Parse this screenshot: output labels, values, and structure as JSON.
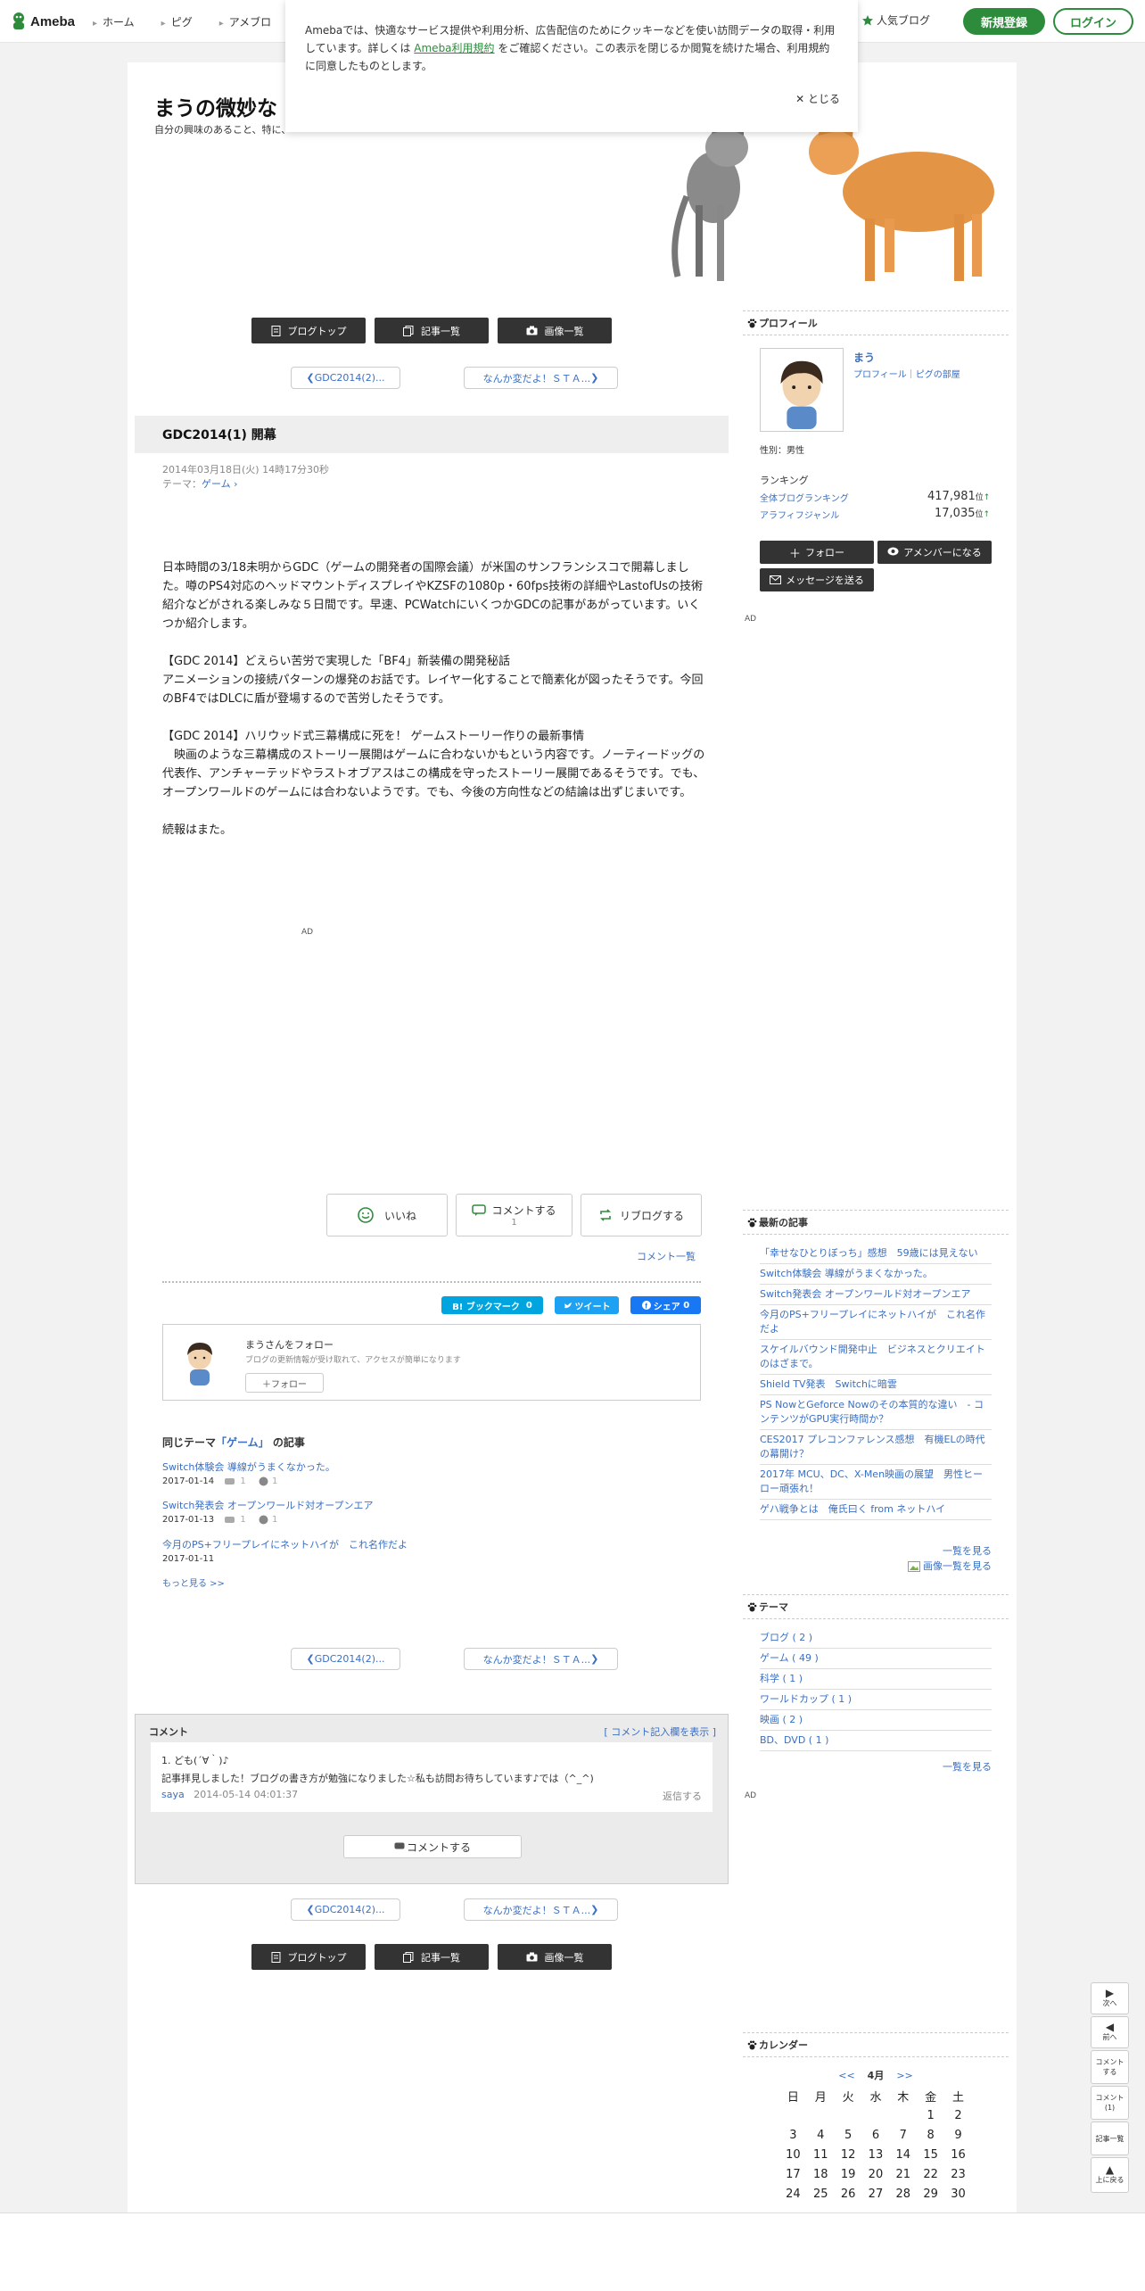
{
  "header": {
    "logo": "Ameba",
    "nav": [
      "ホーム",
      "ピグ",
      "アメブロ"
    ],
    "popular": "人気ブログ",
    "register": "新規登録",
    "login": "ログイン"
  },
  "cookie": {
    "text_before": "Amebaでは、快適なサービス提供や利用分析、広告配信のためにクッキーなどを使い訪問データの取得・利用しています。詳しくは",
    "link": "Ameba利用規約",
    "text_after": "をご確認ください。この表示を閉じるか閲覧を続けた場合、利用規約に同意したものとします。",
    "close": "とじる"
  },
  "blog": {
    "title": "まうの微妙な",
    "description": "自分の興味のあること、特に、"
  },
  "nav_buttons": [
    "ブログトップ",
    "記事一覧",
    "画像一覧"
  ],
  "pager": {
    "prev": "GDC2014(2)...",
    "next": "なんか変だよ！ＳＴＡ..."
  },
  "entry": {
    "title": "GDC2014(1) 開幕",
    "date": "2014年03月18日(火) 14時17分30秒",
    "theme_label": "テーマ：",
    "theme": "ゲーム",
    "paragraphs": [
      "日本時間の3/18未明からGDC（ゲームの開発者の国際会議）が米国のサンフランシスコで開幕しました。噂のPS4対応のヘッドマウントディスプレイやKZSFの1080p・60fps技術の詳細やLastofUsの技術紹介などがされる楽しみな５日間です。早速、PCWatchにいくつかGDCの記事があがっています。いくつか紹介します。",
      "【GDC 2014】どえらい苦労で実現した「BF4」新装備の開発秘話\nアニメーションの接続パターンの爆発のお話です。レイヤー化することで簡素化が図ったそうです。今回のBF4ではDLCに盾が登場するので苦労したそうです。",
      "【GDC 2014】ハリウッド式三幕構成に死を！ ゲームストーリー作りの最新事情\n　映画のような三幕構成のストーリー展開はゲームに合わないかもという内容です。ノーティードッグの代表作、アンチャーテッドやラストオブアスはこの構成を守ったストーリー展開であるそうです。でも、オープンワールドのゲームには合わないようです。でも、今後の方向性などの結論は出ずじまいです。",
      "続報はまた。"
    ],
    "ad": "AD"
  },
  "reactions": {
    "like": "いいね",
    "comment": "コメントする",
    "comment_count": "1",
    "reblog": "リブログする",
    "comment_list": "コメント一覧"
  },
  "share": {
    "hatena": "B! ブックマーク",
    "hatena_count": "0",
    "tweet": "ツイート",
    "fb": "シェア",
    "fb_count": "0"
  },
  "follow_box": {
    "title": "まうさんをフォロー",
    "desc": "ブログの更新情報が受け取れて、アクセスが簡単になります",
    "button": "フォロー"
  },
  "related": {
    "prefix": "同じテーマ",
    "theme": "「ゲーム」",
    "suffix": "の記事",
    "items": [
      {
        "title": "Switch体験会 導線がうまくなかった。",
        "date": "2017-01-14",
        "c": "1",
        "l": "1"
      },
      {
        "title": "Switch発表会 オープンワールド対オープンエア",
        "date": "2017-01-13",
        "c": "1",
        "l": "1"
      },
      {
        "title": "今月のPS+フリープレイにネットハイが　これ名作だよ",
        "date": "2017-01-11"
      }
    ],
    "more": "もっと見る >>"
  },
  "comments": {
    "title": "コメント",
    "open": "[ コメント記入欄を表示 ]",
    "items": [
      {
        "no": "1. ども(´∀｀)♪",
        "body": "記事拝見しました！ブログの書き方が勉強になりました☆私も訪問お待ちしています♪では（^_^)",
        "author": "saya",
        "date": "2014-05-14 04:01:37",
        "reply": "返信する"
      }
    ],
    "button": "コメントする"
  },
  "sidebar": {
    "profile": {
      "head": "プロフィール",
      "name": "まう",
      "links": "プロフィール｜ピグの部屋",
      "gender": "性別：男性",
      "ranking": "ランキング",
      "r1": "全体ブログランキング",
      "v1": "417,981",
      "r2": "アラフィフジャンル",
      "v2": "17,035",
      "unit": "位",
      "follow": "フォロー",
      "amember": "アメンバーになる",
      "message": "メッセージを送る",
      "ad": "AD"
    },
    "recent": {
      "head": "最新の記事",
      "items": [
        "「幸せなひとりぼっち」感想　59歳には見えない",
        "Switch体験会 導線がうまくなかった。",
        "Switch発表会 オープンワールド対オープンエア",
        "今月のPS+フリープレイにネットハイが　これ名作だよ",
        "スケイルバウンド開発中止　ビジネスとクリエイトのはざまで。",
        "Shield TV発表　Switchに暗雲",
        "PS NowとGeforce Nowのその本質的な違い　- コンテンツがGPU実行時間か？",
        "CES2017 プレコンファレンス感想　有機ELの時代の幕開け？",
        "2017年 MCU、DC、X-Men映画の展望　男性ヒーロー頑張れ！",
        "ゲハ戦争とは　俺氏曰く from ネットハイ"
      ],
      "more": "一覧を見る",
      "images": "画像一覧を見る"
    },
    "theme": {
      "head": "テーマ",
      "items": [
        "ブログ ( 2 )",
        "ゲーム ( 49 )",
        "科学 ( 1 )",
        "ワールドカップ ( 1 )",
        "映画 ( 2 )",
        "BD、DVD ( 1 )"
      ],
      "more": "一覧を見る",
      "ad": "AD"
    },
    "calendar": {
      "head": "カレンダー",
      "prev": "<<",
      "month": "4月",
      "next": ">>",
      "weekdays": [
        "日",
        "月",
        "火",
        "水",
        "木",
        "金",
        "土"
      ],
      "rows": [
        [
          "",
          "",
          "",
          "",
          "",
          "1",
          "2"
        ],
        [
          "3",
          "4",
          "5",
          "6",
          "7",
          "8",
          "9"
        ],
        [
          "10",
          "11",
          "12",
          "13",
          "14",
          "15",
          "16"
        ],
        [
          "17",
          "18",
          "19",
          "20",
          "21",
          "22",
          "23"
        ],
        [
          "24",
          "25",
          "26",
          "27",
          "28",
          "29",
          "30"
        ]
      ]
    }
  },
  "floating": {
    "next": "次へ",
    "prev": "前へ",
    "comment": "コメント\nする",
    "comment_count": "コメント\n(1)",
    "list": "記事一覧",
    "top": "上に戻る"
  }
}
